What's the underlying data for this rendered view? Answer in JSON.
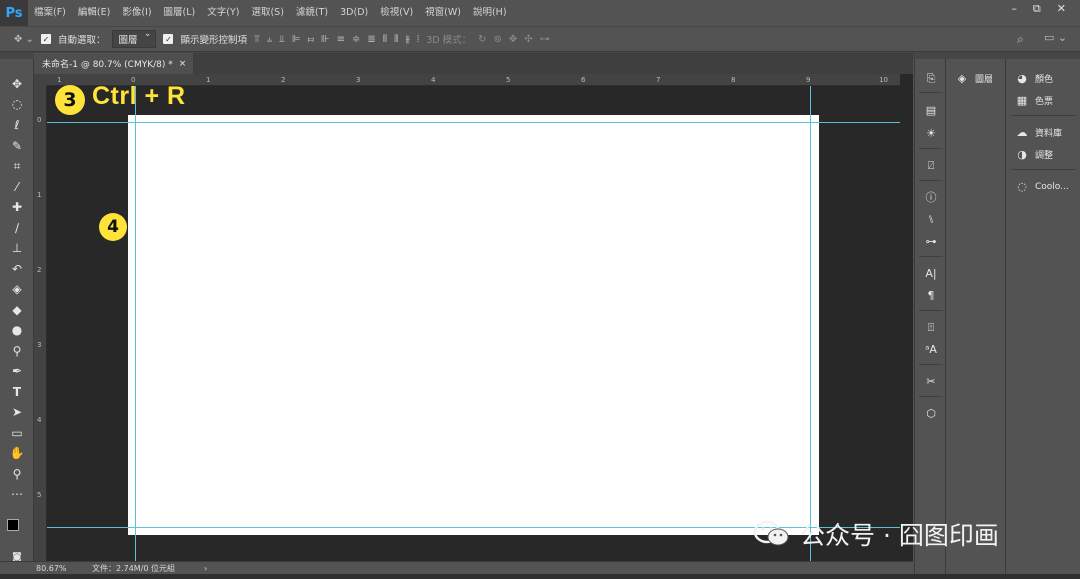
{
  "app": {
    "logo": "Ps"
  },
  "menubar": {
    "items": [
      "檔案(F)",
      "編輯(E)",
      "影像(I)",
      "圖層(L)",
      "文字(Y)",
      "選取(S)",
      "濾鏡(T)",
      "3D(D)",
      "檢視(V)",
      "視窗(W)",
      "說明(H)"
    ]
  },
  "window_controls": {
    "minimize": "–",
    "restore": "⧉",
    "close": "✕"
  },
  "options": {
    "auto_select_label": "自動選取：",
    "auto_select_checked": true,
    "auto_select_value": "圖層",
    "show_transform_label": "顯示變形控制項",
    "show_transform_checked": true,
    "mode_3d_label": "3D 模式："
  },
  "document": {
    "tab_title": "未命名-1 @ 80.7% (CMYK/8) *",
    "tab_close": "×",
    "ruler_top": [
      "1",
      "0",
      "1",
      "2",
      "3",
      "4",
      "5",
      "6",
      "7",
      "8",
      "9",
      "10"
    ],
    "ruler_left": [
      "0",
      "1",
      "2",
      "3",
      "4",
      "5"
    ]
  },
  "annotations": {
    "step3_number": "3",
    "step3_text": "Ctrl + R",
    "step4_number": "4"
  },
  "status": {
    "zoom": "80.67%",
    "doc_info": "文件：2.74M/0 位元組",
    "arrow": "›"
  },
  "panels": {
    "layers_label": "圖層",
    "right_items": [
      {
        "icon": "palette-icon",
        "label": "顏色"
      },
      {
        "icon": "grid-icon",
        "label": "色票"
      },
      {
        "icon": "library-icon",
        "label": "資料庫"
      },
      {
        "icon": "adjust-icon",
        "label": "調整"
      },
      {
        "icon": "cooler-icon",
        "label": "Coolo..."
      }
    ]
  },
  "watermark": {
    "text": "公众号 · 囧图印画"
  },
  "colors": {
    "accent_yellow": "#ffe33a",
    "guide": "#5bc3d9",
    "ps_blue": "#31a8ff",
    "workspace": "#282828",
    "ui_gray": "#535353"
  }
}
